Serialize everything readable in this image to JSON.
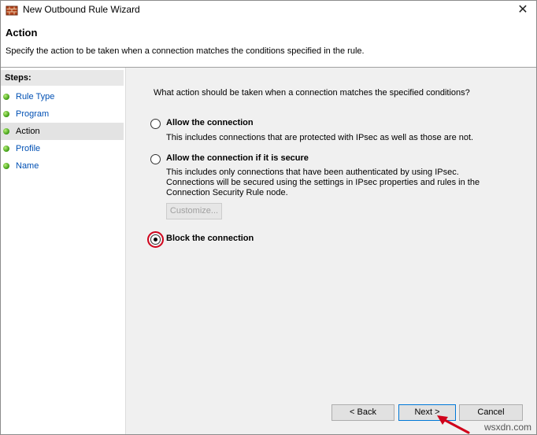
{
  "window": {
    "title": "New Outbound Rule Wizard",
    "close_glyph": "✕"
  },
  "header": {
    "title": "Action",
    "description": "Specify the action to be taken when a connection matches the conditions specified in the rule."
  },
  "steps": {
    "title": "Steps:",
    "items": [
      {
        "label": "Rule Type"
      },
      {
        "label": "Program"
      },
      {
        "label": "Action"
      },
      {
        "label": "Profile"
      },
      {
        "label": "Name"
      }
    ],
    "current": "Action"
  },
  "main": {
    "question": "What action should be taken when a connection matches the specified conditions?",
    "options": [
      {
        "label": "Allow the connection",
        "description": "This includes connections that are protected with IPsec as well as those are not.",
        "checked": false
      },
      {
        "label": "Allow the connection if it is secure",
        "description": "This includes only connections that have been authenticated by using IPsec.  Connections will be secured using the settings in IPsec properties and rules in the Connection Security Rule node.",
        "checked": false
      },
      {
        "label": "Block the connection",
        "description": "",
        "checked": true
      }
    ],
    "customize_label": "Customize..."
  },
  "footer": {
    "back_label": "< Back",
    "next_label": "Next >",
    "cancel_label": "Cancel"
  },
  "colors": {
    "link": "#0050b4",
    "highlight": "#d0021b",
    "accent": "#0078d7"
  },
  "icons": {
    "app": "firewall-wall-icon",
    "step": "green-dot-icon",
    "annotation": "red-arrow-icon"
  },
  "watermark": "wsxdn.com"
}
